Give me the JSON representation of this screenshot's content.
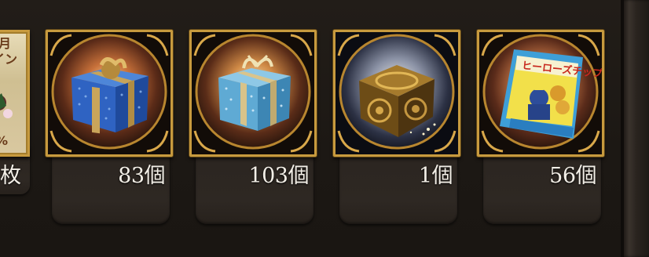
{
  "inventory": {
    "partial_item": {
      "count_label": "枚",
      "art_text": [
        "月",
        "イン",
        "%"
      ]
    },
    "items": [
      {
        "name_icon": "blue-gift-box-icon",
        "count": "83個"
      },
      {
        "name_icon": "light-blue-gift-box-icon",
        "count": "103個"
      },
      {
        "name_icon": "golden-cube-icon",
        "count": "1個"
      },
      {
        "name_icon": "heroes-chips-bag-icon",
        "count": "56個",
        "package_text": "ヒーローズチップ"
      }
    ]
  },
  "colors": {
    "background": "#1d1915",
    "frame_gold": "#c79a3e",
    "plate": "#2e2823",
    "count_text": "#f3efe7"
  }
}
